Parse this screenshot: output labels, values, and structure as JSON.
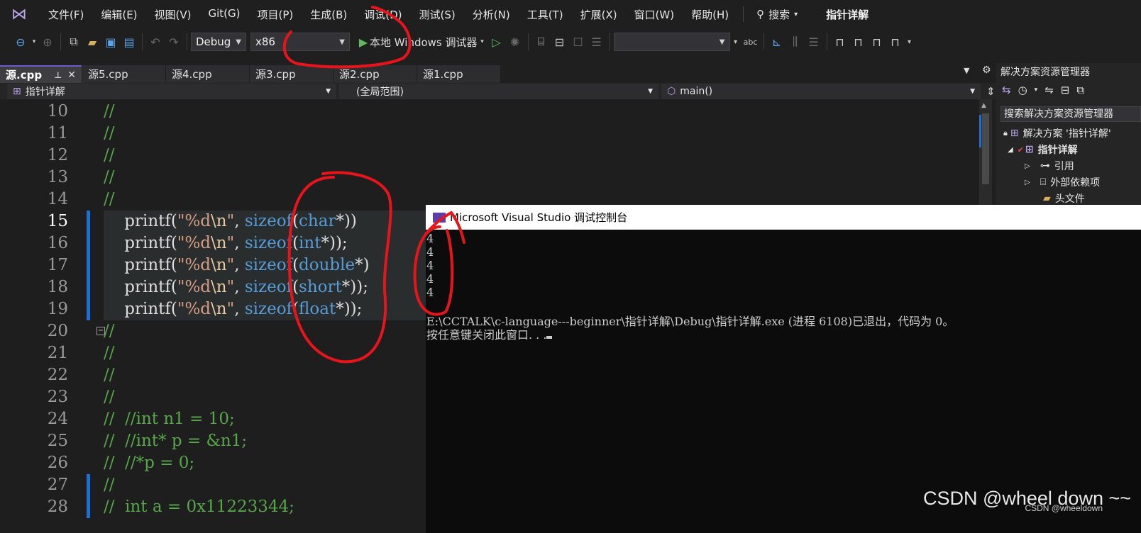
{
  "menu": {
    "items": [
      "文件(F)",
      "编辑(E)",
      "视图(V)",
      "Git(G)",
      "项目(P)",
      "生成(B)",
      "调试(D)",
      "测试(S)",
      "分析(N)",
      "工具(T)",
      "扩展(X)",
      "窗口(W)",
      "帮助(H)"
    ],
    "search_label": "搜索",
    "window_title": "指针详解"
  },
  "toolbar": {
    "config": "Debug",
    "platform": "x86",
    "run_label": "本地 Windows 调试器"
  },
  "tabs": [
    {
      "label": "源.cpp",
      "active": true
    },
    {
      "label": "源5.cpp"
    },
    {
      "label": "源4.cpp"
    },
    {
      "label": "源3.cpp"
    },
    {
      "label": "源2.cpp"
    },
    {
      "label": "源1.cpp"
    }
  ],
  "nav": {
    "project": "指针详解",
    "scope": "(全局范围)",
    "member": "main()"
  },
  "editor": {
    "lines": [
      {
        "n": "10",
        "parts": [
          {
            "t": "//",
            "c": "cm"
          }
        ]
      },
      {
        "n": "11",
        "parts": [
          {
            "t": "//",
            "c": "cm"
          }
        ]
      },
      {
        "n": "12",
        "parts": [
          {
            "t": "//",
            "c": "cm"
          }
        ]
      },
      {
        "n": "13",
        "parts": [
          {
            "t": "//",
            "c": "cm"
          }
        ]
      },
      {
        "n": "14",
        "parts": [
          {
            "t": "//",
            "c": "cm"
          }
        ]
      },
      {
        "n": "15",
        "hl": true,
        "parts": [
          {
            "t": "    printf(",
            "c": ""
          },
          {
            "t": "\"%d",
            "c": "str"
          },
          {
            "t": "\\n",
            "c": "esc"
          },
          {
            "t": "\"",
            "c": "str"
          },
          {
            "t": ", ",
            "c": ""
          },
          {
            "t": "sizeof",
            "c": "kw"
          },
          {
            "t": "(",
            "c": ""
          },
          {
            "t": "char",
            "c": "kw"
          },
          {
            "t": "*))",
            "c": ""
          }
        ]
      },
      {
        "n": "16",
        "hl": true,
        "parts": [
          {
            "t": "    printf(",
            "c": ""
          },
          {
            "t": "\"%d",
            "c": "str"
          },
          {
            "t": "\\n",
            "c": "esc"
          },
          {
            "t": "\"",
            "c": "str"
          },
          {
            "t": ", ",
            "c": ""
          },
          {
            "t": "sizeof",
            "c": "kw"
          },
          {
            "t": "(",
            "c": ""
          },
          {
            "t": "int",
            "c": "kw"
          },
          {
            "t": "*));",
            "c": ""
          }
        ]
      },
      {
        "n": "17",
        "hl": true,
        "parts": [
          {
            "t": "    printf(",
            "c": ""
          },
          {
            "t": "\"%d",
            "c": "str"
          },
          {
            "t": "\\n",
            "c": "esc"
          },
          {
            "t": "\"",
            "c": "str"
          },
          {
            "t": ", ",
            "c": ""
          },
          {
            "t": "sizeof",
            "c": "kw"
          },
          {
            "t": "(",
            "c": ""
          },
          {
            "t": "double",
            "c": "kw"
          },
          {
            "t": "*)",
            "c": ""
          }
        ]
      },
      {
        "n": "18",
        "hl": true,
        "parts": [
          {
            "t": "    printf(",
            "c": ""
          },
          {
            "t": "\"%d",
            "c": "str"
          },
          {
            "t": "\\n",
            "c": "esc"
          },
          {
            "t": "\"",
            "c": "str"
          },
          {
            "t": ", ",
            "c": ""
          },
          {
            "t": "sizeof",
            "c": "kw"
          },
          {
            "t": "(",
            "c": ""
          },
          {
            "t": "short",
            "c": "kw"
          },
          {
            "t": "*));",
            "c": ""
          }
        ]
      },
      {
        "n": "19",
        "hl": true,
        "parts": [
          {
            "t": "    printf(",
            "c": ""
          },
          {
            "t": "\"%d",
            "c": "str"
          },
          {
            "t": "\\n",
            "c": "esc"
          },
          {
            "t": "\"",
            "c": "str"
          },
          {
            "t": ", ",
            "c": ""
          },
          {
            "t": "sizeof",
            "c": "kw"
          },
          {
            "t": "(",
            "c": ""
          },
          {
            "t": "float",
            "c": "kw"
          },
          {
            "t": "*));",
            "c": ""
          }
        ]
      },
      {
        "n": "20",
        "parts": [
          {
            "t": "//",
            "c": "cm"
          }
        ]
      },
      {
        "n": "21",
        "parts": [
          {
            "t": "//",
            "c": "cm"
          }
        ]
      },
      {
        "n": "22",
        "parts": [
          {
            "t": "//",
            "c": "cm"
          }
        ]
      },
      {
        "n": "23",
        "parts": [
          {
            "t": "//",
            "c": "cm"
          }
        ]
      },
      {
        "n": "24",
        "parts": [
          {
            "t": "//  //int n1 = 10;",
            "c": "cm"
          }
        ]
      },
      {
        "n": "25",
        "parts": [
          {
            "t": "//  //int* p = &n1;",
            "c": "cm"
          }
        ]
      },
      {
        "n": "26",
        "parts": [
          {
            "t": "//  //*p = 0;",
            "c": "cm"
          }
        ]
      },
      {
        "n": "27",
        "parts": [
          {
            "t": "//",
            "c": "cm"
          }
        ]
      },
      {
        "n": "28",
        "parts": [
          {
            "t": "//  int a = 0x11223344;",
            "c": "cm"
          }
        ]
      }
    ]
  },
  "solution": {
    "title": "解决方案资源管理器",
    "search": "搜索解决方案资源管理器",
    "solution_node": "解决方案 '指针详解'",
    "project_node": "指针详解",
    "children": [
      "引用",
      "外部依赖项",
      "头文件"
    ]
  },
  "console": {
    "title": "Microsoft Visual Studio 调试控制台",
    "output": [
      "4",
      "4",
      "4",
      "4",
      "4"
    ],
    "exit_message": "E:\\CCTALK\\c-language---beginner\\指针详解\\Debug\\指针详解.exe (进程 6108)已退出，代码为 0。",
    "prompt": "按任意键关闭此窗口. . ."
  },
  "watermark": {
    "main": "CSDN @wheel down ~~",
    "small": "CSDN @wheeldown"
  },
  "colors": {
    "annotation": "#e8141b",
    "accent": "#6a5acd",
    "change_bar": "#1b6fd6"
  }
}
